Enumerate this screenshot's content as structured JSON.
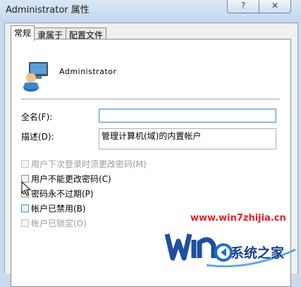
{
  "window": {
    "title": "Administrator 属性",
    "help_label": "?",
    "close_label": "✕"
  },
  "tabs": [
    {
      "label": "常规"
    },
    {
      "label": "隶属于"
    },
    {
      "label": "配置文件"
    }
  ],
  "user": {
    "name": "Administrator",
    "icon": "user-icon"
  },
  "fields": {
    "fullname": {
      "label": "全名(F):",
      "value": ""
    },
    "description": {
      "label": "描述(D):",
      "value": "管理计算机(域)的内置帐户"
    }
  },
  "checkboxes": [
    {
      "label": "用户下次登录时须更改密码(M)",
      "checked": false,
      "enabled": false
    },
    {
      "label": "用户不能更改密码(C)",
      "checked": false,
      "enabled": true
    },
    {
      "label": "密码永不过期(P)",
      "checked": true,
      "enabled": true
    },
    {
      "label": "帐户已禁用(B)",
      "checked": false,
      "enabled": true
    },
    {
      "label": "帐户已锁定(O)",
      "checked": false,
      "enabled": false
    }
  ],
  "watermark": {
    "url": "www.win7zhijia.cn",
    "brand": "系统之家"
  }
}
